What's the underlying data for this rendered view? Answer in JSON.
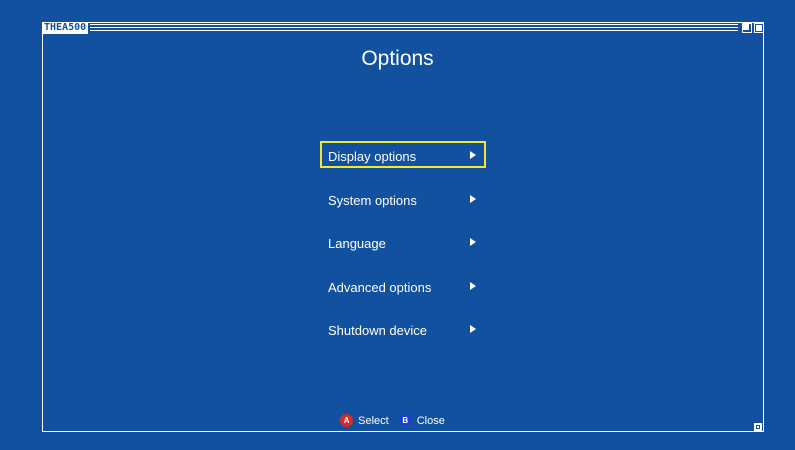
{
  "window": {
    "title": "THEA500"
  },
  "screen": {
    "title": "Options"
  },
  "menu": {
    "items": [
      {
        "label": "Display options",
        "selected": true
      },
      {
        "label": "System options",
        "selected": false
      },
      {
        "label": "Language",
        "selected": false
      },
      {
        "label": "Advanced options",
        "selected": false
      },
      {
        "label": "Shutdown device",
        "selected": false
      }
    ]
  },
  "footer": {
    "a_button": "A",
    "a_label": "Select",
    "b_button": "B",
    "b_label": "Close"
  },
  "colors": {
    "background": "#1251a0",
    "selection": "#f2ea29",
    "a_button": "#d92a2a",
    "b_button": "#1d3fcf"
  },
  "icons": {
    "menu_arrow": "chevron-right-icon",
    "window_buttons": [
      "minimize-icon",
      "maximize-icon"
    ],
    "resize": "resize-grip-icon"
  }
}
